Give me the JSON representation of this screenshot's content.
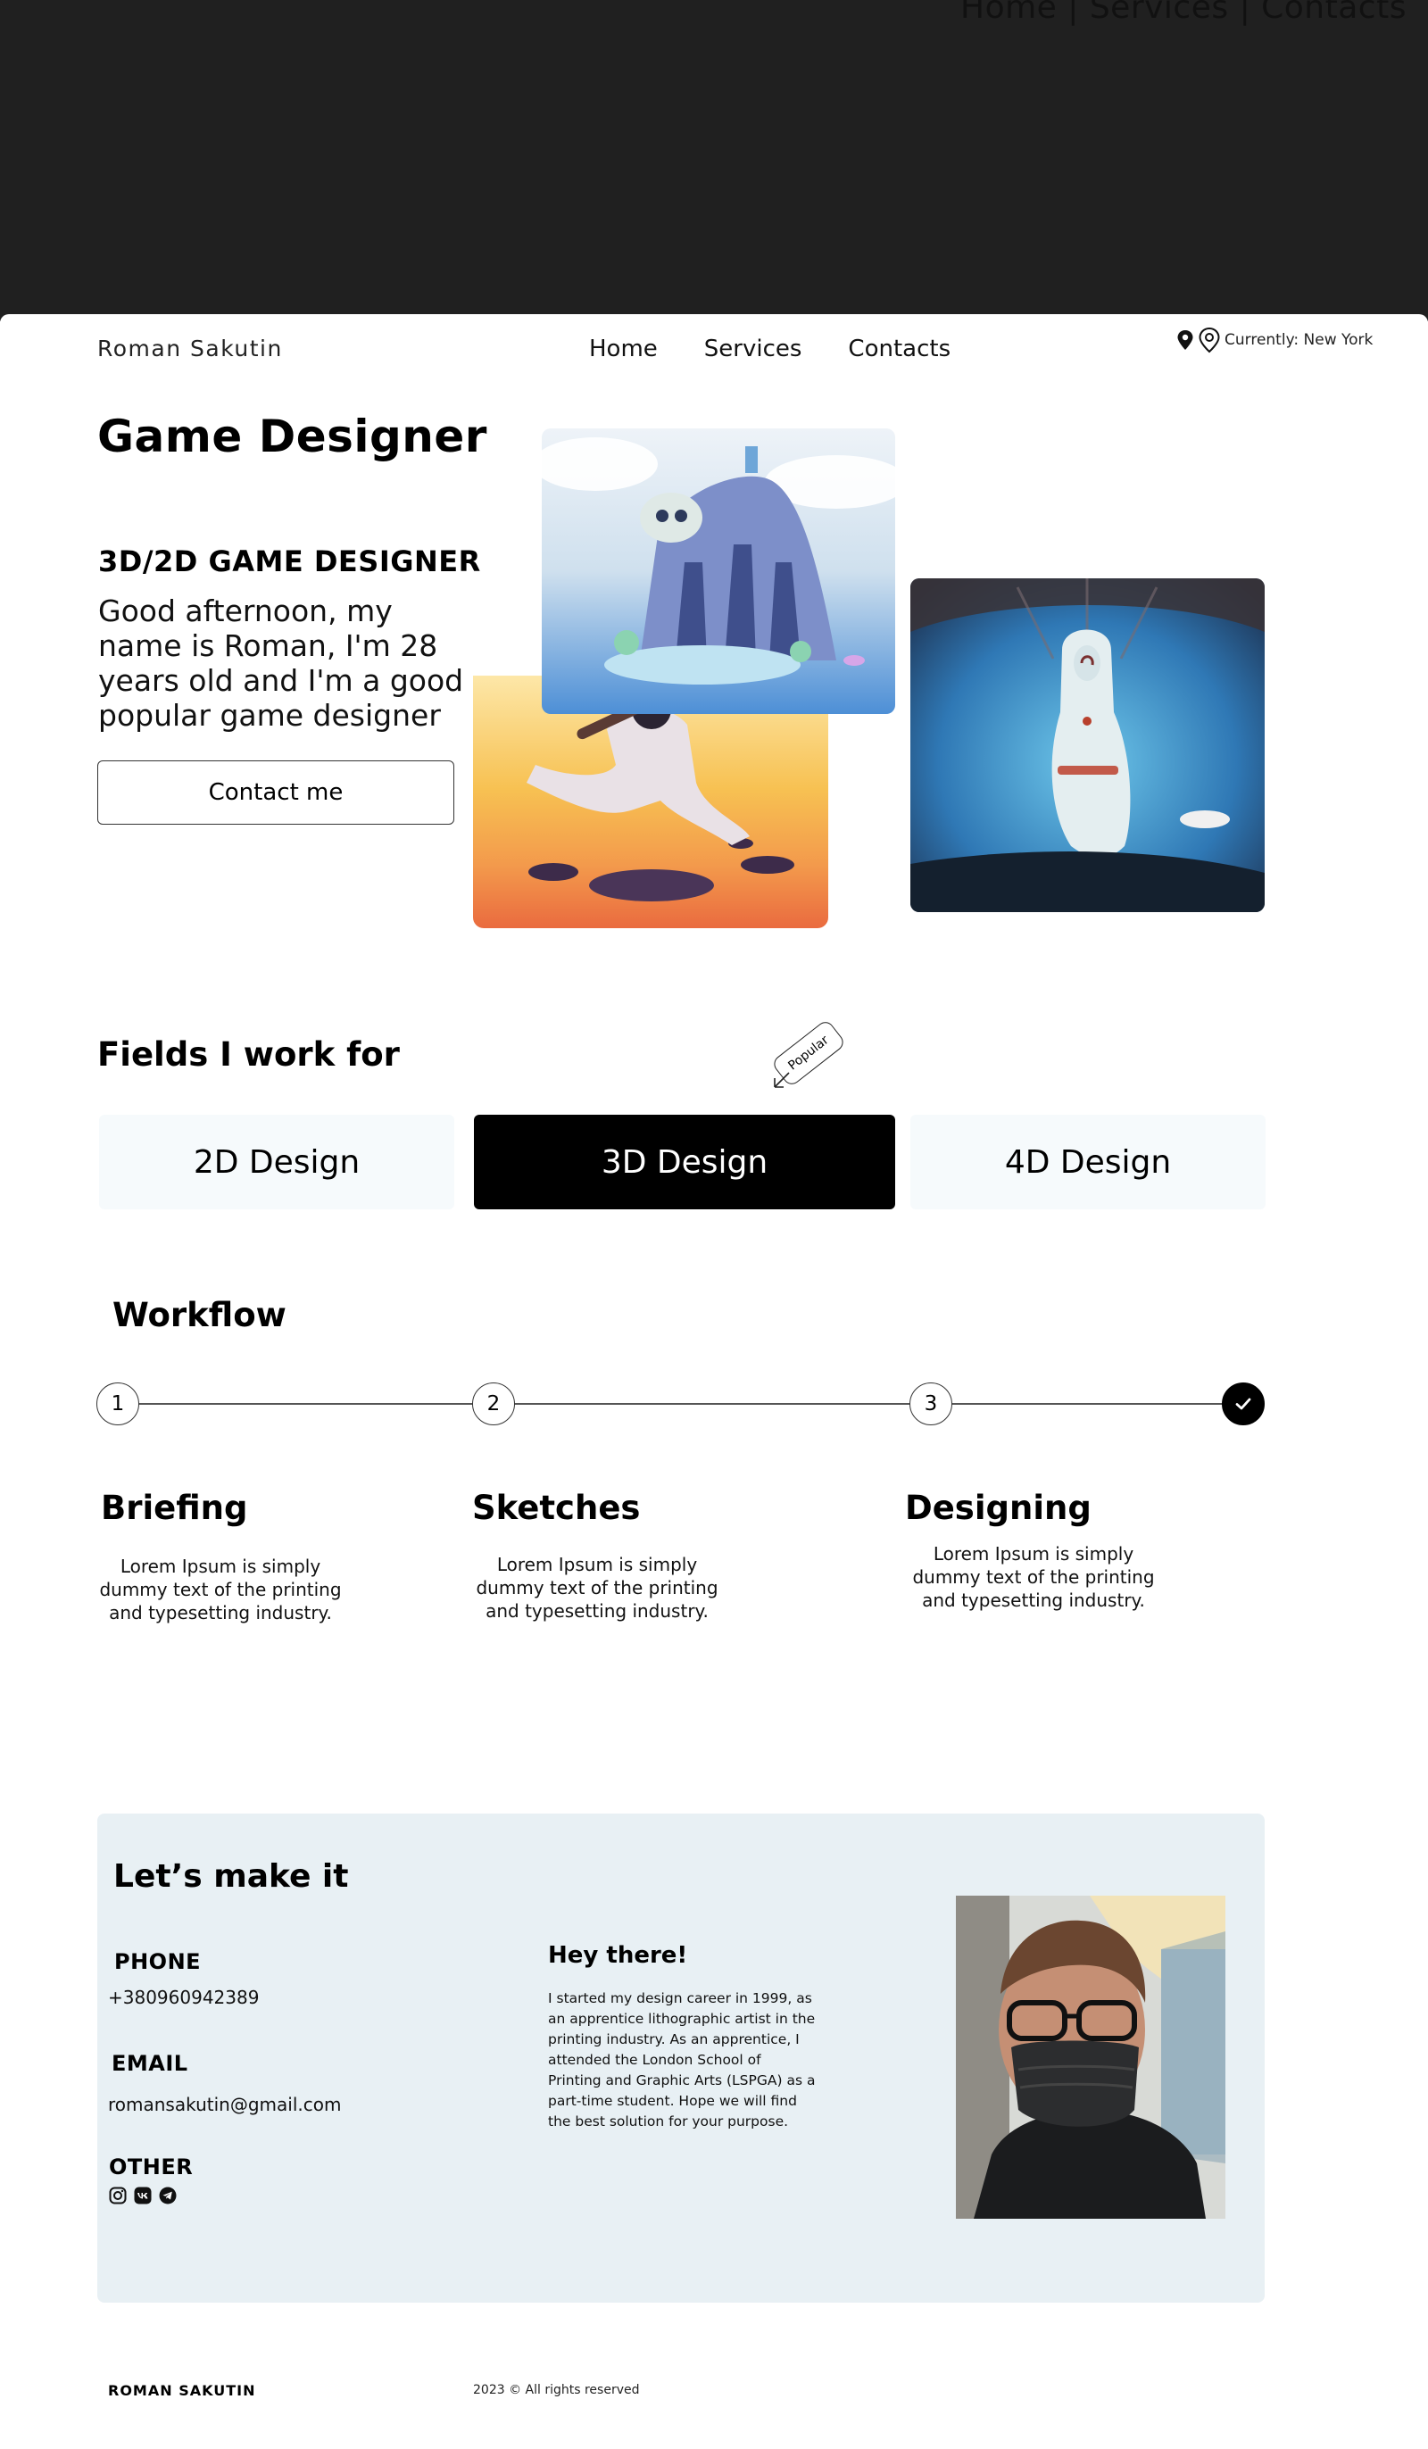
{
  "overlay": {
    "nav_text": "Home | Services | Contacts"
  },
  "header": {
    "brand": "Roman Sakutin",
    "nav": [
      "Home",
      "Services",
      "Contacts"
    ],
    "location": "Currently: New York"
  },
  "hero": {
    "title": "Game Designer",
    "subtitle": "3D/2D GAME DESIGNER",
    "description": "Good afternoon, my name is Roman, I'm 28 years old and I'm a good popular game designer",
    "cta_label": "Contact me"
  },
  "fields": {
    "title": "Fields I work for",
    "popular_tag": "Popular",
    "items": [
      "2D Design",
      "3D Design",
      "4D Design"
    ]
  },
  "workflow": {
    "title": "Workflow",
    "steps": [
      {
        "number": "1",
        "title": "Briefing",
        "text": "Lorem Ipsum is simply dummy text of the printing and typesetting industry."
      },
      {
        "number": "2",
        "title": "Sketches",
        "text": "Lorem Ipsum is simply dummy text of the printing and typesetting industry."
      },
      {
        "number": "3",
        "title": "Designing",
        "text": "Lorem Ipsum is simply dummy text of the printing and typesetting industry."
      }
    ]
  },
  "contact": {
    "title": "Let’s make it",
    "phone_label": "PHONE",
    "phone": "+380960942389",
    "email_label": "EMAIL",
    "email": "romansakutin@gmail.com",
    "other_label": "OTHER",
    "socials": [
      "instagram-icon",
      "vk-icon",
      "telegram-icon"
    ],
    "greeting": "Hey there!",
    "bio": "I started my design career in 1999, as an apprentice lithographic artist in the printing industry. As an apprentice, I attended the London School of Printing and Graphic Arts (LSPGA) as a part-time student. Hope we will find the best solution for your purpose."
  },
  "footer": {
    "brand": "ROMAN SAKUTIN",
    "copyright": "2023 © All rights reserved"
  },
  "colors": {
    "overlay": "#202020",
    "card_bg": "#e8f0f4",
    "field_bg": "#f6fafc",
    "active_field": "#000000"
  }
}
